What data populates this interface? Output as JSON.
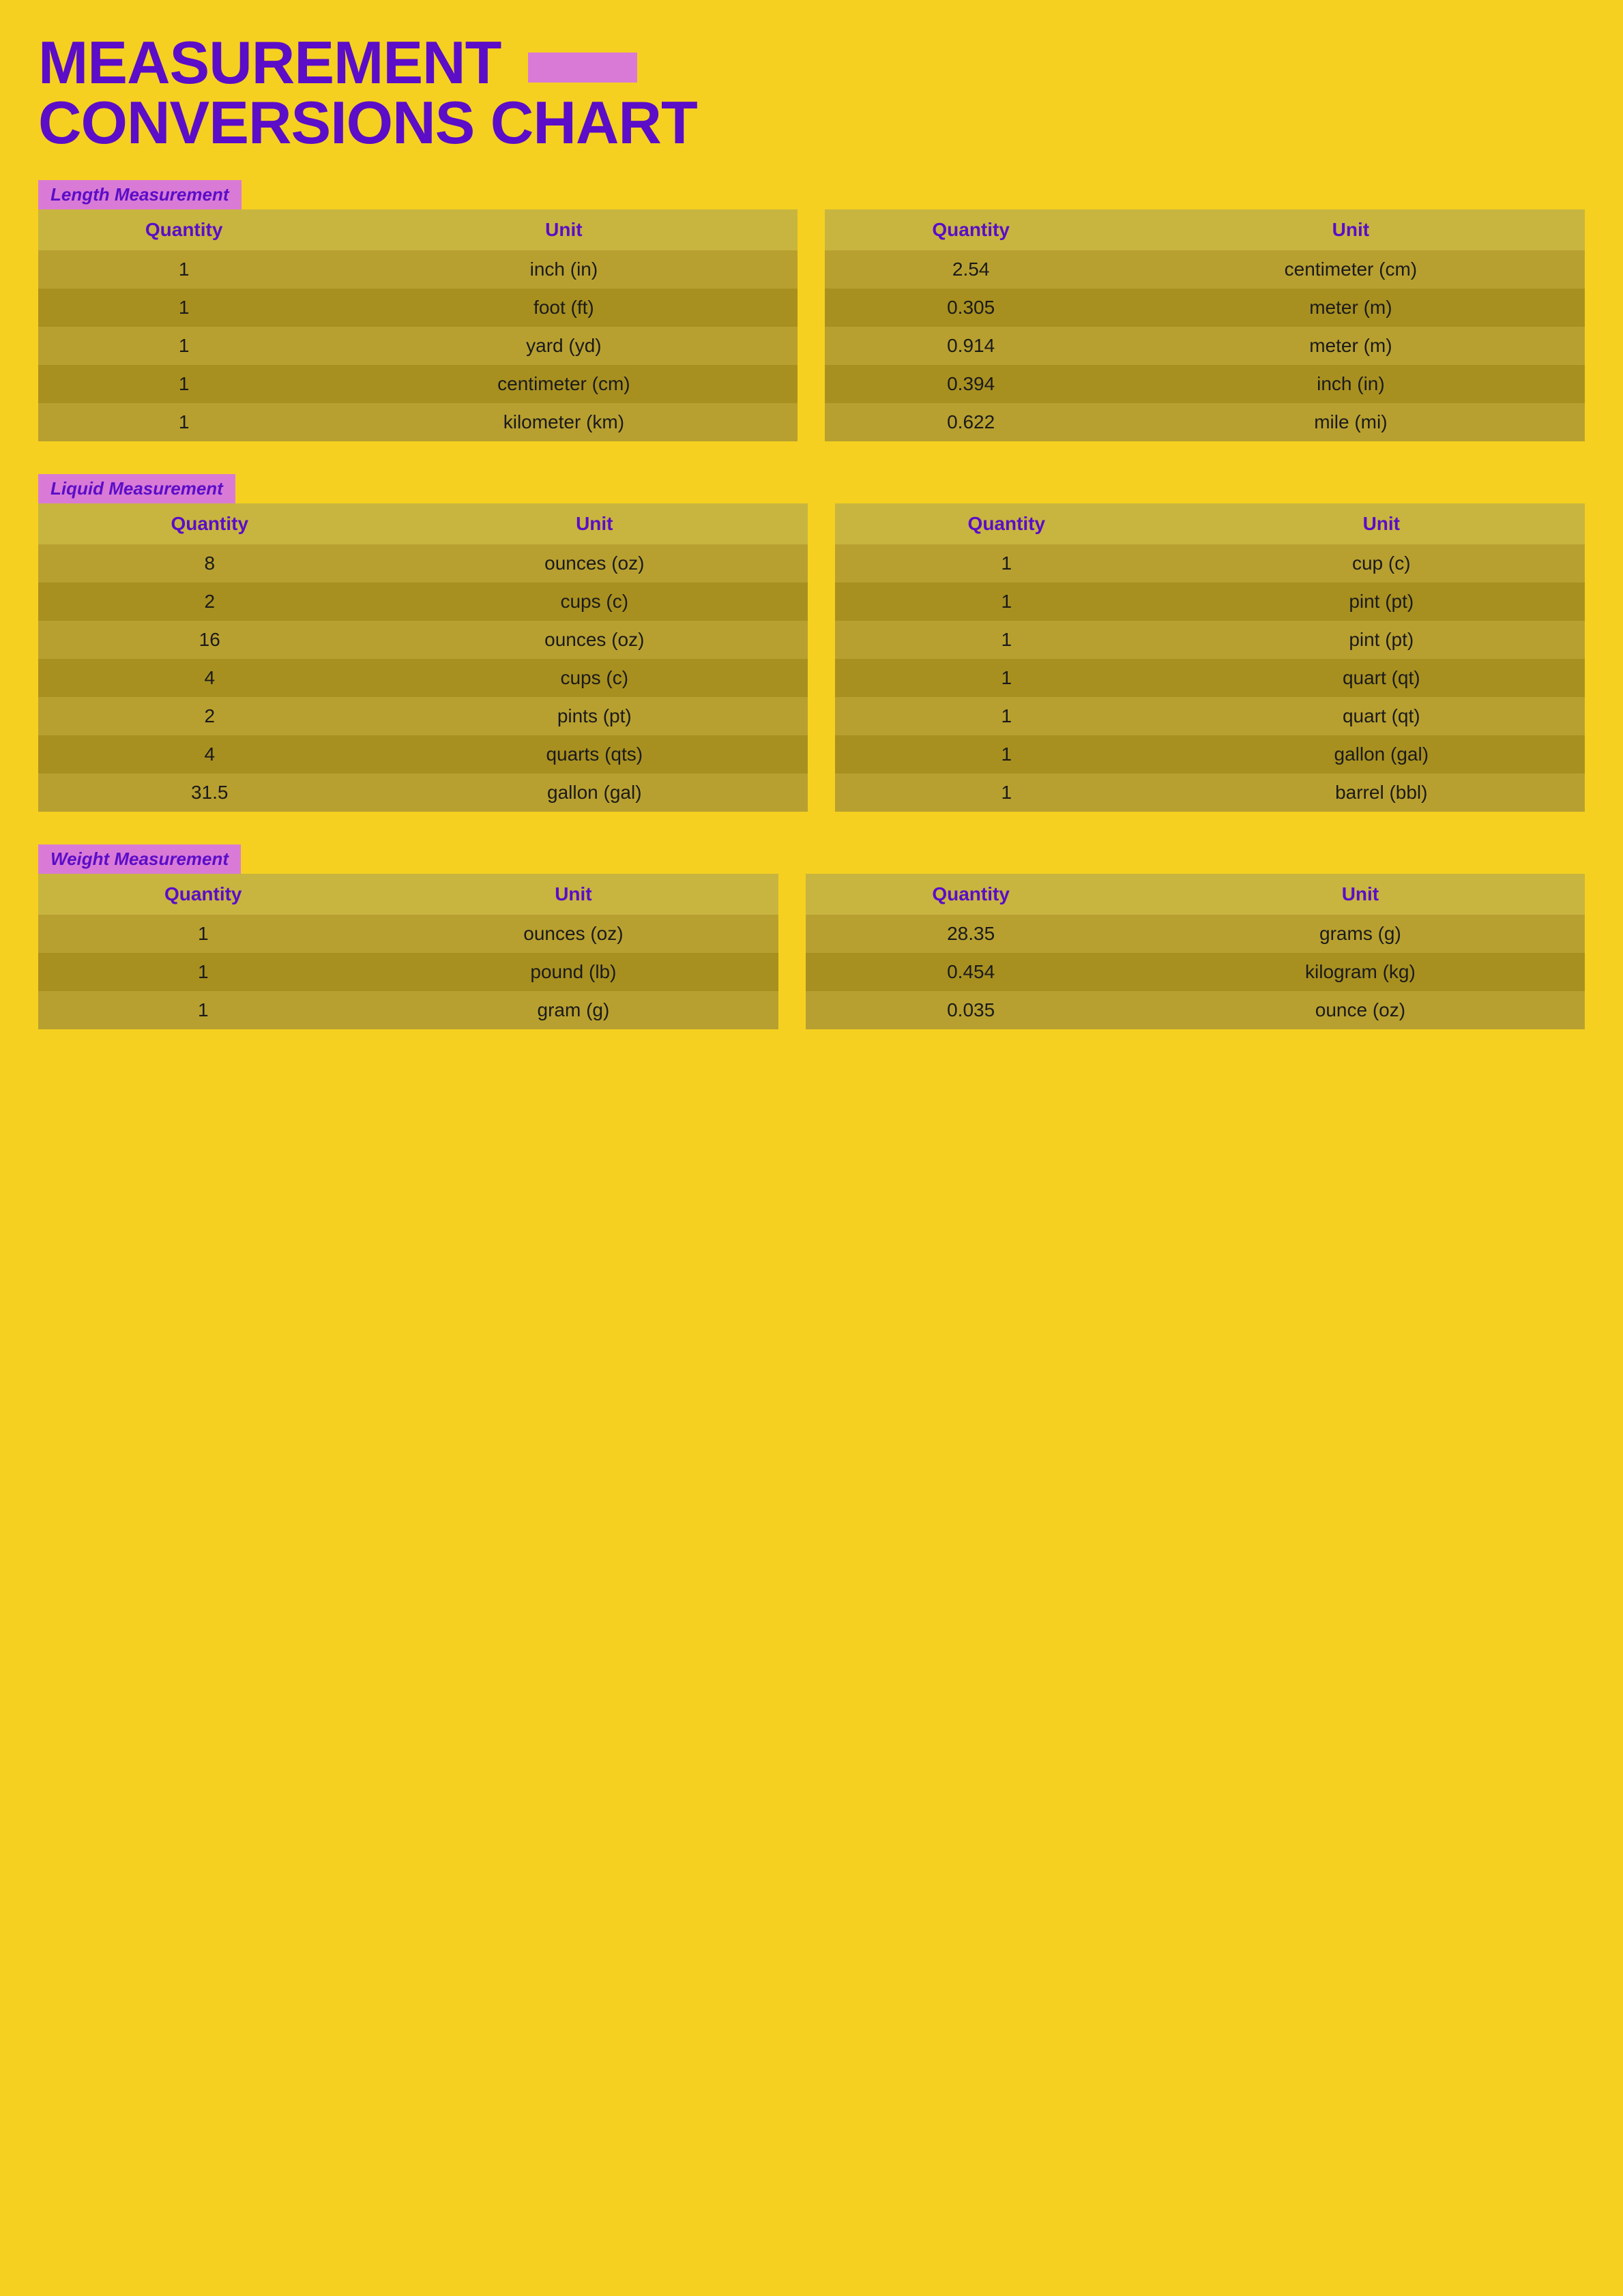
{
  "title": {
    "line1": "MEASUREMENT",
    "line2": "CONVERSIONS CHART"
  },
  "sections": [
    {
      "id": "length",
      "label": "Length Measurement",
      "headers": [
        "Quantity",
        "Unit",
        "Quantity",
        "Unit"
      ],
      "rows": [
        [
          "1",
          "inch (in)",
          "2.54",
          "centimeter (cm)"
        ],
        [
          "1",
          "foot (ft)",
          "0.305",
          "meter (m)"
        ],
        [
          "1",
          "yard (yd)",
          "0.914",
          "meter (m)"
        ],
        [
          "1",
          "centimeter (cm)",
          "0.394",
          "inch (in)"
        ],
        [
          "1",
          "kilometer (km)",
          "0.622",
          "mile (mi)"
        ]
      ]
    },
    {
      "id": "liquid",
      "label": "Liquid Measurement",
      "headers": [
        "Quantity",
        "Unit",
        "Quantity",
        "Unit"
      ],
      "rows": [
        [
          "8",
          "ounces (oz)",
          "1",
          "cup (c)"
        ],
        [
          "2",
          "cups (c)",
          "1",
          "pint (pt)"
        ],
        [
          "16",
          "ounces (oz)",
          "1",
          "pint (pt)"
        ],
        [
          "4",
          "cups (c)",
          "1",
          "quart (qt)"
        ],
        [
          "2",
          "pints (pt)",
          "1",
          "quart (qt)"
        ],
        [
          "4",
          "quarts (qts)",
          "1",
          "gallon (gal)"
        ],
        [
          "31.5",
          "gallon (gal)",
          "1",
          "barrel (bbl)"
        ]
      ]
    },
    {
      "id": "weight",
      "label": "Weight Measurement",
      "headers": [
        "Quantity",
        "Unit",
        "Quantity",
        "Unit"
      ],
      "rows": [
        [
          "1",
          "ounces (oz)",
          "28.35",
          "grams (g)"
        ],
        [
          "1",
          "pound (lb)",
          "0.454",
          "kilogram (kg)"
        ],
        [
          "1",
          "gram (g)",
          "0.035",
          "ounce (oz)"
        ]
      ]
    }
  ]
}
